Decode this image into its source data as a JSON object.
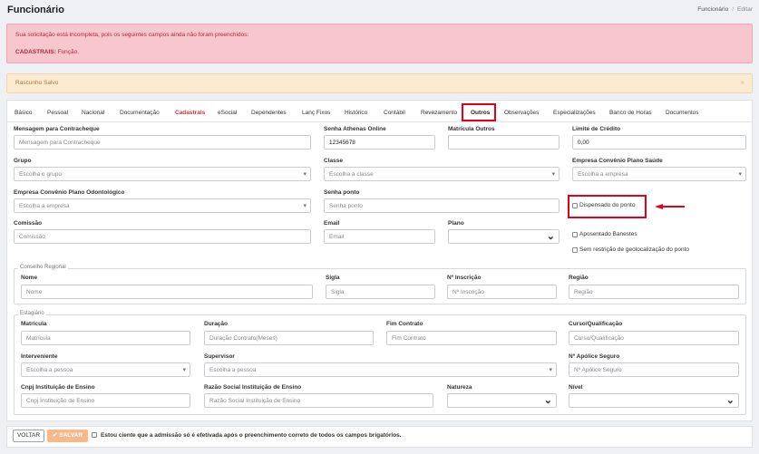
{
  "header": {
    "title": "Funcionário",
    "breadcrumb": [
      "Funcionário",
      "Editar"
    ]
  },
  "alert_error": {
    "line1": "Sua solicitação está incompleta, pois os seguintes campos ainda não foram preenchidos:",
    "section": "CADASTRAIS:",
    "fields": "Função."
  },
  "alert_warning": {
    "text": "Rascunho Salvo",
    "close": "×"
  },
  "tabs": [
    "Básico",
    "Pessoal",
    "Nacional",
    "Documentação",
    "Cadastrais",
    "eSocial",
    "Dependentes",
    "Lanç Fixos",
    "Histórico",
    "Contábil",
    "Revezamento",
    "Outros",
    "Observações",
    "Especializações",
    "Banco de Horas",
    "Documentos"
  ],
  "form": {
    "mensagem": {
      "label": "Mensagem para Contracheque",
      "placeholder": "Mensagem para Contracheque"
    },
    "senha_athenas": {
      "label": "Senha Athenas Online",
      "value": "12345678"
    },
    "matricula_outros": {
      "label": "Matrícula Outros",
      "value": ""
    },
    "limite_credito": {
      "label": "Limite de Crédito",
      "value": "0,00"
    },
    "grupo": {
      "label": "Grupo",
      "placeholder": "Escolha o grupo"
    },
    "classe": {
      "label": "Classe",
      "placeholder": "Escolha a classe"
    },
    "plano_saude": {
      "label": "Empresa Convênio Plano Saúde",
      "placeholder": "Escolha a empresa"
    },
    "plano_odonto": {
      "label": "Empresa Convênio Plano Odontológico",
      "placeholder": "Escolha a empresa"
    },
    "senha_ponto": {
      "label": "Senha ponto",
      "placeholder": "Senha ponto"
    },
    "dispensado_ponto": {
      "label": "Dispensado do ponto"
    },
    "comissao": {
      "label": "Comissão",
      "placeholder": "Comissão"
    },
    "email": {
      "label": "Email",
      "placeholder": "Email"
    },
    "plano": {
      "label": "Plano",
      "value": ""
    },
    "aposentado": {
      "label": "Aposentado Banestes"
    },
    "geolocalizacao": {
      "label": "Sem restrição de geolocalização do ponto"
    }
  },
  "conselho": {
    "legend": "Conselho Regional",
    "nome": {
      "label": "Nome",
      "placeholder": "Nome"
    },
    "sigla": {
      "label": "Sigla",
      "placeholder": "Sigla"
    },
    "inscricao": {
      "label": "Nº Inscrição",
      "placeholder": "Nº Inscrição"
    },
    "regiao": {
      "label": "Região",
      "placeholder": "Região"
    }
  },
  "estagiario": {
    "legend": "Estagiário",
    "matricula": {
      "label": "Matrícula",
      "placeholder": "Matrícula"
    },
    "duracao": {
      "label": "Duração",
      "placeholder": "Duração Contrato(Meses)"
    },
    "fim_contrato": {
      "label": "Fim Contrato",
      "placeholder": "Fim Contrato"
    },
    "curso": {
      "label": "Curso/Qualificação",
      "placeholder": "Curso/Qualificação"
    },
    "interveniente": {
      "label": "Interveniente",
      "placeholder": "Escolha a pessoa"
    },
    "supervisor": {
      "label": "Supervisor",
      "placeholder": "Escolha a pessoa"
    },
    "apolice": {
      "label": "Nº Apólice Seguro",
      "placeholder": "Nº Apólice Seguro"
    },
    "cnpj": {
      "label": "Cnpj Instituição de Ensino",
      "placeholder": "Cnpj Instituição de Ensino"
    },
    "razao": {
      "label": "Razão Social Instituição de Ensino",
      "placeholder": "Razão Social Instituição de Ensino"
    },
    "natureza": {
      "label": "Natureza",
      "value": ""
    },
    "nivel": {
      "label": "Nível",
      "value": ""
    }
  },
  "footer": {
    "voltar": "VOLTAR",
    "salvar": "SALVAR",
    "note": "Estou ciente que a admissão só é efetivada após o preenchimento correto de todos os campos brigatórios."
  },
  "colors": {
    "highlight": "#e4001b",
    "accent_orange": "#f7b98a",
    "error_bg": "#f8c7cd",
    "warning_bg": "#fcebd0"
  }
}
